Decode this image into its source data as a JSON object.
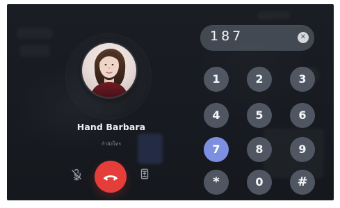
{
  "call": {
    "name": "Hand Barbara",
    "status": "กำลังโทร"
  },
  "dialer": {
    "number": "187",
    "clear_icon": "✕",
    "keys": [
      "1",
      "2",
      "3",
      "4",
      "5",
      "6",
      "7",
      "8",
      "9",
      "*",
      "0",
      "#"
    ],
    "active_key": "7"
  },
  "icons": {
    "mute": "mic-off-icon",
    "hangup": "phone-hangup-icon",
    "switch": "phone-switch-icon"
  },
  "colors": {
    "background": "#171a20",
    "accent": "#e53e3a",
    "keypad": "#5a616c",
    "active_key": "#7d8fe0"
  }
}
